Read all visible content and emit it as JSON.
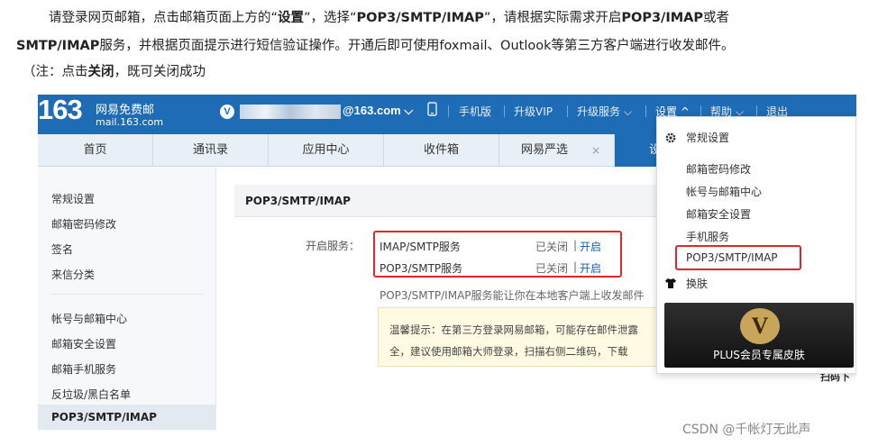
{
  "intro": {
    "line1_a": "请登录网页邮箱，点击邮箱页面上方的“",
    "line1_b": "设置",
    "line1_c": "”，选择“",
    "line1_d": "POP3/SMTP/IMAP",
    "line1_e": "”，请根据实际需求开启",
    "line1_f": "POP3/IMAP",
    "line1_g": "或者",
    "line2_a": "SMTP/IMAP",
    "line2_b": "服务，并根据页面提示进行短信验证操作。开通后即可使用foxmail、Outlook等第三方客户端进行收发邮件。",
    "line3_a": "（注：点击",
    "line3_b": "关闭",
    "line3_c": "，既可关闭成功"
  },
  "topbar": {
    "logo_number": "163",
    "logo_title": "网易免费邮",
    "logo_domain": "mail.163.com",
    "vip_badge": "V",
    "account": "@163.com",
    "account_arrow": "⌵",
    "links": [
      "手机版",
      "升级VIP",
      "升级服务 ⌵",
      "设置 ^",
      "帮助 ⌵",
      "退出"
    ]
  },
  "nav": {
    "tabs": [
      "首页",
      "通讯录",
      "应用中心",
      "收件箱",
      "网易严选"
    ],
    "close": "×",
    "active_tab": "设"
  },
  "sidebar": {
    "group1": [
      "常规设置",
      "邮箱密码修改",
      "签名",
      "来信分类"
    ],
    "group2": [
      "帐号与邮箱中心",
      "邮箱安全设置",
      "邮箱手机服务",
      "反垃圾/黑白名单"
    ],
    "active": "POP3/SMTP/IMAP"
  },
  "panel": {
    "title": "POP3/SMTP/IMAP",
    "service_label": "开启服务：",
    "services": [
      {
        "name": "IMAP/SMTP服务",
        "status": "已关闭",
        "sep": "|",
        "action": "开启"
      },
      {
        "name": "POP3/SMTP服务",
        "status": "已关闭",
        "sep": "|",
        "action": "开启"
      }
    ],
    "desc": "POP3/SMTP/IMAP服务能让你在本地客户端上收发邮件",
    "tip_line1": "温馨提示：在第三方登录网易邮箱，可能存在邮件泄露",
    "tip_line2": "全，建议使用邮箱大师登录，扫描右侧二维码，下载",
    "corner_text": "扫码下"
  },
  "dropdown": {
    "header": "常规设置",
    "items": [
      "邮箱密码修改",
      "帐号与邮箱中心",
      "邮箱安全设置",
      "手机服务"
    ],
    "highlight": "POP3/SMTP/IMAP",
    "skin": "换肤",
    "plus_badge": "V",
    "plus_caption": "PLUS会员专属皮肤"
  },
  "watermark": "CSDN @千帐灯无此声",
  "colors": {
    "brand_blue": "#1e6cb5",
    "highlight_red": "#e0262a",
    "link_blue": "#1a5fb4"
  }
}
